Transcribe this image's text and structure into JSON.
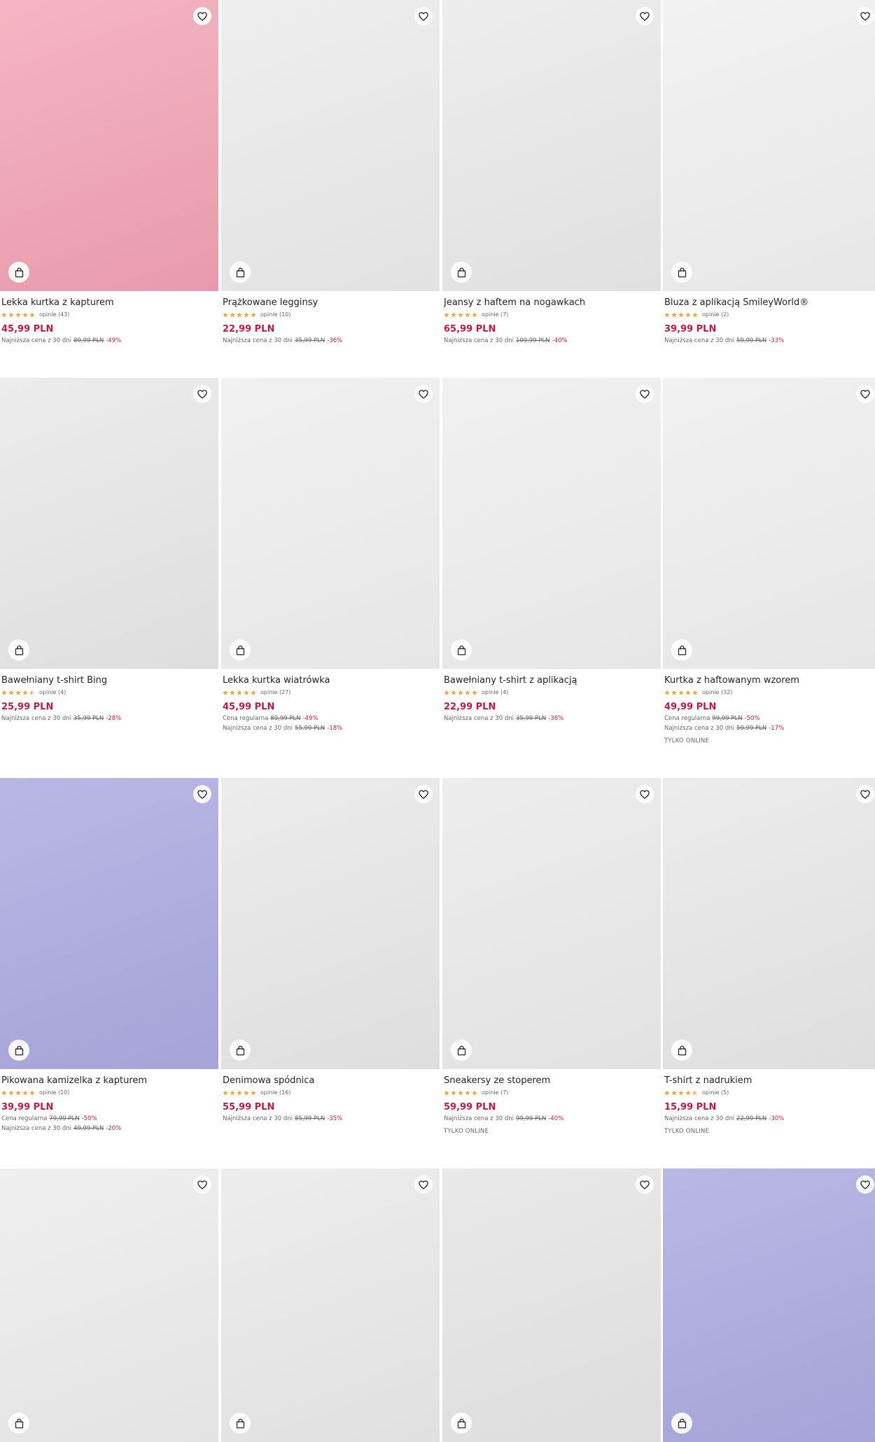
{
  "colors": {
    "price": "#c5183e",
    "discount": "#c5183e",
    "star": "#f2a33a",
    "star_empty": "#dddddd"
  },
  "icons": {
    "wishlist": "heart-icon",
    "add_to_cart": "shopping-bag-icon"
  },
  "products": [
    {
      "name": "Lekka kurtka z kapturem",
      "rating": 5,
      "reviews": "opinie (43)",
      "price": "45,99 PLN",
      "lines": [
        {
          "label": "Najniższa cena z 30 dni",
          "old": "89,99 PLN",
          "disc": "-49%"
        }
      ],
      "online": "",
      "bg": [
        "#f4b6c2",
        "#e89aac"
      ]
    },
    {
      "name": "Prążkowane legginsy",
      "rating": 5,
      "reviews": "opinie (10)",
      "price": "22,99 PLN",
      "lines": [
        {
          "label": "Najniższa cena z 30 dni",
          "old": "35,99 PLN",
          "disc": "-36%"
        }
      ],
      "online": "",
      "bg": [
        "#eeeeee",
        "#e2e2e2"
      ]
    },
    {
      "name": "Jeansy z haftem na nogawkach",
      "rating": 5,
      "reviews": "opinie (7)",
      "price": "65,99 PLN",
      "lines": [
        {
          "label": "Najniższa cena z 30 dni",
          "old": "109,99 PLN",
          "disc": "-40%"
        }
      ],
      "online": "",
      "bg": [
        "#ededed",
        "#e0e0e0"
      ]
    },
    {
      "name": "Bluza z aplikacją SmileyWorld®",
      "rating": 5,
      "reviews": "opinie (2)",
      "price": "39,99 PLN",
      "lines": [
        {
          "label": "Najniższa cena z 30 dni",
          "old": "59,99 PLN",
          "disc": "-33%"
        }
      ],
      "online": "",
      "bg": [
        "#f2f2f2",
        "#e7e7e7"
      ]
    },
    {
      "name": "Bawełniany t-shirt Bing",
      "rating": 4.5,
      "reviews": "opinie (4)",
      "price": "25,99 PLN",
      "lines": [
        {
          "label": "Najniższa cena z 30 dni",
          "old": "35,99 PLN",
          "disc": "-28%"
        }
      ],
      "online": "",
      "bg": [
        "#ececec",
        "#dedede"
      ]
    },
    {
      "name": "Lekka kurtka wiatrówka",
      "rating": 5,
      "reviews": "opinie (27)",
      "price": "45,99 PLN",
      "lines": [
        {
          "label": "Cena regularna",
          "old": "89,99 PLN",
          "disc": "-49%"
        },
        {
          "label": "Najniższa cena z 30 dni",
          "old": "55,99 PLN",
          "disc": "-18%"
        }
      ],
      "online": "",
      "bg": [
        "#f1f1f1",
        "#e6e6e6"
      ]
    },
    {
      "name": "Bawełniany t-shirt z aplikacją",
      "rating": 5,
      "reviews": "opinie (4)",
      "price": "22,99 PLN",
      "lines": [
        {
          "label": "Najniższa cena z 30 dni",
          "old": "35,99 PLN",
          "disc": "-36%"
        }
      ],
      "online": "",
      "bg": [
        "#f1f1f1",
        "#e6e6e6"
      ]
    },
    {
      "name": "Kurtka z haftowanym wzorem",
      "rating": 5,
      "reviews": "opinie (32)",
      "price": "49,99 PLN",
      "lines": [
        {
          "label": "Cena regularna",
          "old": "99,99 PLN",
          "disc": "-50%"
        },
        {
          "label": "Najniższa cena z 30 dni",
          "old": "59,99 PLN",
          "disc": "-17%"
        }
      ],
      "online": "TYLKO ONLINE",
      "bg": [
        "#f1f1f1",
        "#e6e6e6"
      ]
    },
    {
      "name": "Pikowana kamizelka z kapturem",
      "rating": 5,
      "reviews": "opinie (10)",
      "price": "39,99 PLN",
      "lines": [
        {
          "label": "Cena regularna",
          "old": "79,99 PLN",
          "disc": "-50%"
        },
        {
          "label": "Najniższa cena z 30 dni",
          "old": "49,99 PLN",
          "disc": "-20%"
        }
      ],
      "online": "",
      "bg": [
        "#b9b8e4",
        "#a5a3d8"
      ]
    },
    {
      "name": "Denimowa spódnica",
      "rating": 5,
      "reviews": "opinie (16)",
      "price": "55,99 PLN",
      "lines": [
        {
          "label": "Najniższa cena z 30 dni",
          "old": "85,99 PLN",
          "disc": "-35%"
        }
      ],
      "online": "",
      "bg": [
        "#ececec",
        "#dedede"
      ]
    },
    {
      "name": "Sneakersy ze stoperem",
      "rating": 5,
      "reviews": "opinie (7)",
      "price": "59,99 PLN",
      "lines": [
        {
          "label": "Najniższa cena z 30 dni",
          "old": "99,99 PLN",
          "disc": "-40%"
        }
      ],
      "online": "TYLKO ONLINE",
      "bg": [
        "#ededed",
        "#e2e2e2"
      ]
    },
    {
      "name": "T-shirt z nadrukiem",
      "rating": 4.5,
      "reviews": "opinie (5)",
      "price": "15,99 PLN",
      "lines": [
        {
          "label": "Najniższa cena z 30 dni",
          "old": "22,99 PLN",
          "disc": "-30%"
        }
      ],
      "online": "TYLKO ONLINE",
      "bg": [
        "#ececec",
        "#dedede"
      ]
    },
    {
      "name": "",
      "rating": 0,
      "reviews": "",
      "price": "",
      "lines": [],
      "online": "",
      "bg": [
        "#efefef",
        "#e3e3e3"
      ]
    },
    {
      "name": "",
      "rating": 0,
      "reviews": "",
      "price": "",
      "lines": [],
      "online": "",
      "bg": [
        "#ededed",
        "#e0e0e0"
      ]
    },
    {
      "name": "",
      "rating": 0,
      "reviews": "",
      "price": "",
      "lines": [],
      "online": "",
      "bg": [
        "#e9e9e9",
        "#dddddd"
      ]
    },
    {
      "name": "",
      "rating": 0,
      "reviews": "",
      "price": "",
      "lines": [],
      "online": "",
      "bg": [
        "#b9b8e4",
        "#a5a3d8"
      ]
    }
  ]
}
